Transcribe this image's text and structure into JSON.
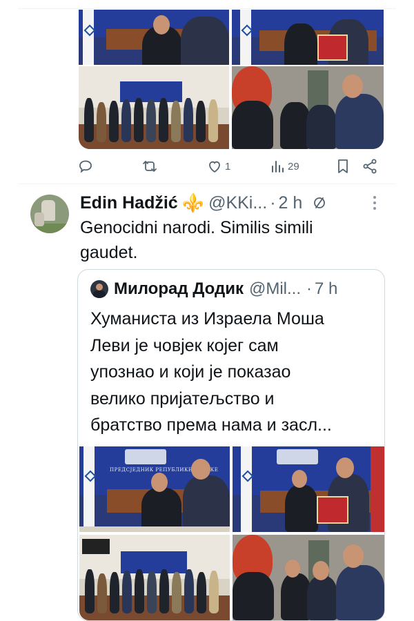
{
  "tweet1": {
    "actions": {
      "reply_icon": "reply-icon",
      "retweet_icon": "retweet-icon",
      "like_icon": "like-icon",
      "like_count": "1",
      "views_icon": "views-icon",
      "views_count": "29",
      "bookmark_icon": "bookmark-icon",
      "share_icon": "share-icon"
    }
  },
  "tweet2": {
    "author": "Edin Hadžić",
    "emoji": "⚜️",
    "handle": "@KKi...",
    "separator": "·",
    "time": "2 h",
    "text_line1": "Genocidni narodi. Similis simili",
    "text_line2": "gaudet.",
    "quote": {
      "author": "Милорад Додик",
      "handle": "@Mil...",
      "separator": "·",
      "time": "7 h",
      "lines": [
        "Хуманиста из Израела Моша",
        "Леви је човјек којег сам",
        "упознао и који је показао",
        "велико пријатељство и",
        "братство према нама и засл..."
      ],
      "banner_caption": "ПРЕДСЈЕДНИК РЕПУБЛИКЕ СРПСКЕ"
    }
  },
  "colors": {
    "text_primary": "#0f1419",
    "text_secondary": "#536471",
    "border": "#cfd9de",
    "emoji_gold": "#e0a800"
  }
}
